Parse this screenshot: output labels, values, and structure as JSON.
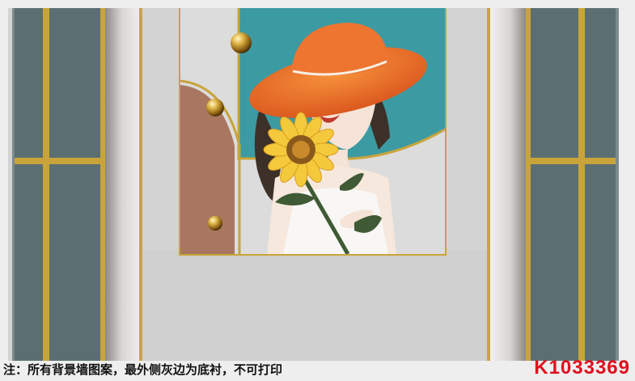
{
  "design": {
    "footer_note": "注：所有背景墙图案，最外侧灰边为底衬，不可打印",
    "product_code": "K1033369",
    "colors": {
      "slate_panel": "#5b6f73",
      "gold_trim": "#c9a43a",
      "teal_arch": "#3c9aa2",
      "terracotta_arch": "#a9765f",
      "hat_orange": "#ec6a2a",
      "wall_grey": "#d3d3d4",
      "code_red": "#e0101e"
    },
    "icons": [
      "gold-sphere-icon",
      "sunflower-icon",
      "sun-hat-icon"
    ]
  }
}
